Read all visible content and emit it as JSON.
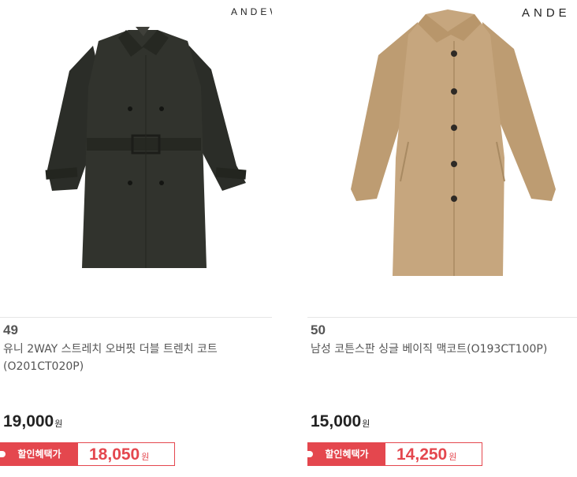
{
  "products": [
    {
      "brand": "ANDEW",
      "rank": "49",
      "title": "유니 2WAY 스트레치 오버핏 더블 트렌치 코트(O201CT020P)",
      "price": "19,000",
      "currency": "원",
      "deal_label": "할인혜택가",
      "deal_price": "18,050",
      "coat_color": "#2f312b"
    },
    {
      "brand": "ANDE",
      "rank": "50",
      "title": "남성 코튼스판 싱글 베이직 맥코트(O193CT100P)",
      "price": "15,000",
      "currency": "원",
      "deal_label": "할인혜택가",
      "deal_price": "14,250",
      "coat_color": "#c4a47c"
    }
  ],
  "accent_color": "#e4474e"
}
